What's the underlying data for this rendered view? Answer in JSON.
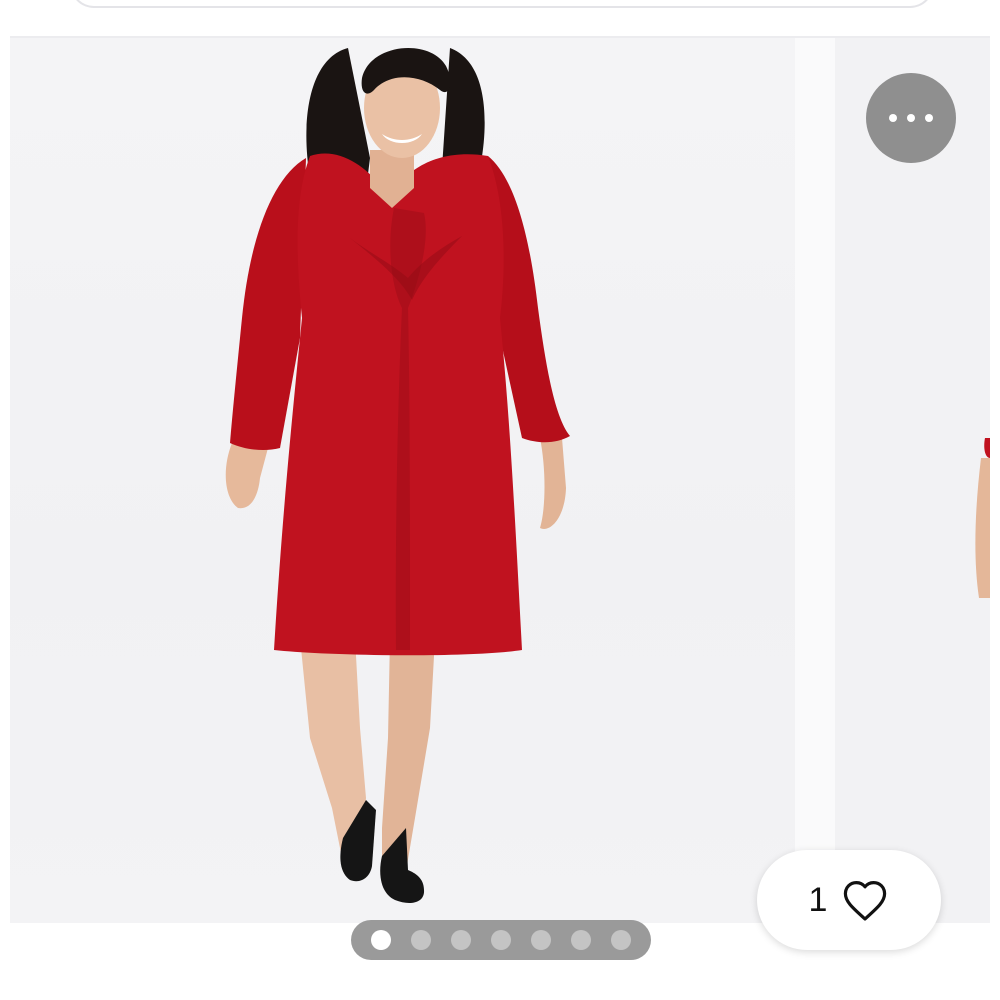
{
  "gallery": {
    "more_options_icon": "ellipsis-icon",
    "like_icon": "heart-outline-icon",
    "like_count": "1",
    "image_count": 7,
    "active_image": 1,
    "dress_color": "#c0121f",
    "accent_gray": "#8f8f8f"
  }
}
